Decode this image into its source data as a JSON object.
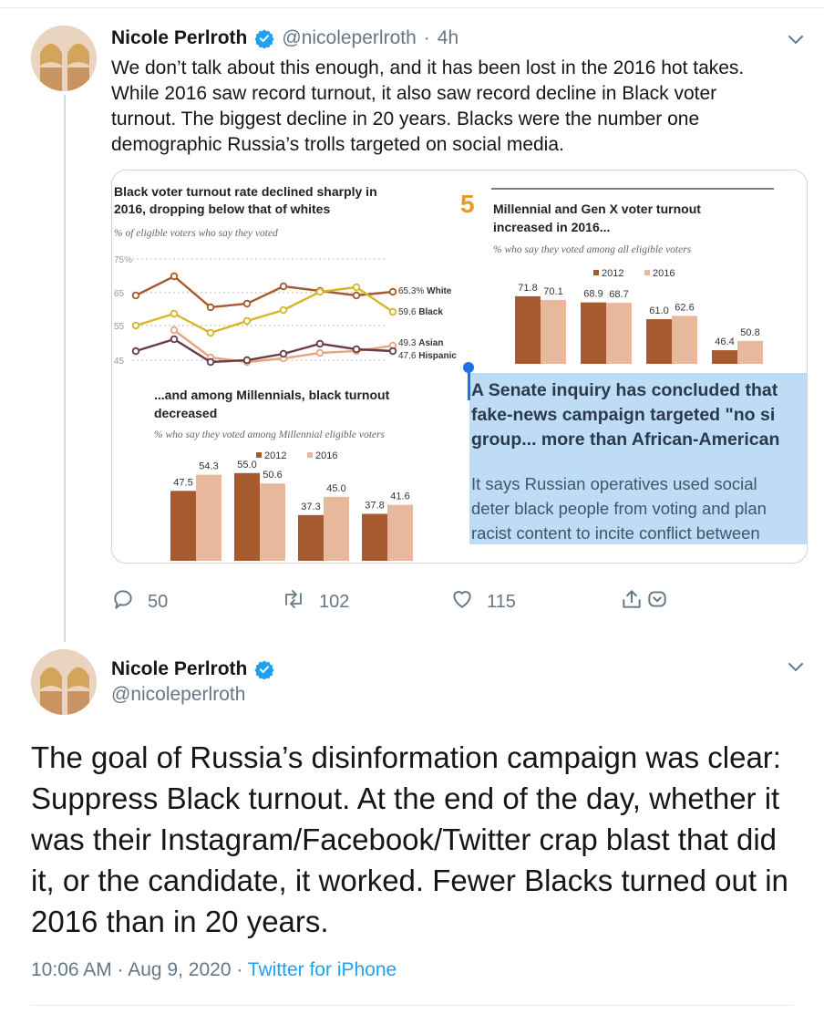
{
  "tweet1": {
    "name": "Nicole Perlroth",
    "handle": "@nicoleperlroth",
    "time": "4h",
    "text": "We don’t talk about this enough, and it has been lost in the 2016 hot takes. While 2016 saw record turnout, it also saw record decline in Black voter turnout. The biggest decline in 20 years. Blacks were the number one demographic Russia’s trolls targeted on social media.",
    "actions": {
      "replies": "50",
      "retweets": "102",
      "likes": "115"
    }
  },
  "media": {
    "line_chart": {
      "title": "Black voter turnout rate declined sharply in 2016, dropping below that of whites",
      "subtitle": "% of eligible voters who say they voted",
      "y_ticks": [
        "75%",
        "65",
        "55",
        "45"
      ],
      "labels": [
        {
          "value": "65.3%",
          "name": "White"
        },
        {
          "value": "59.6",
          "name": "Black"
        },
        {
          "value": "49.3",
          "name": "Asian"
        },
        {
          "value": "47.6",
          "name": "Hispanic"
        }
      ]
    },
    "millennial_chart": {
      "title": "...and among Millennials, black turnout decreased",
      "subtitle": "% who say they voted among Millennial eligible voters",
      "legend": [
        "2012",
        "2016"
      ],
      "values_2012": [
        47.5,
        55.0,
        37.3,
        37.8
      ],
      "values_2016": [
        54.3,
        50.6,
        45.0,
        41.6
      ],
      "labels_2012": [
        "47.5",
        "55.0",
        "37.3",
        "37.8"
      ],
      "labels_2016": [
        "54.3",
        "50.6",
        "45.0",
        "41.6"
      ]
    },
    "genx_chart": {
      "number": "5",
      "title": "Millennial and Gen X voter turnout increased in 2016...",
      "subtitle": "% who say they voted among all eligible voters",
      "legend": [
        "2012",
        "2016"
      ],
      "values_2012": [
        71.8,
        68.9,
        61.0,
        46.4
      ],
      "values_2016": [
        70.1,
        68.7,
        62.6,
        50.8
      ],
      "labels_2012": [
        "71.8",
        "68.9",
        "61.0",
        "46.4"
      ],
      "labels_2016": [
        "70.1",
        "68.7",
        "62.6",
        "50.8"
      ]
    },
    "article": {
      "headline_lines": [
        "A Senate inquiry has concluded that",
        "fake-news campaign targeted \"no si",
        "group... more than African-American"
      ],
      "body_lines": [
        "It says Russian operatives used social",
        "deter black people from voting and plan",
        "racist content to incite conflict between"
      ]
    },
    "colors": {
      "c2012": "#a65a2e",
      "c2016": "#e8b89c",
      "white": "#a65a2e",
      "black": "#d6b528",
      "asian": "#e7a57f",
      "hispanic": "#6b3a4a"
    }
  },
  "tweet2": {
    "name": "Nicole Perlroth",
    "handle": "@nicoleperlroth",
    "text": "The goal of Russia’s disinformation campaign was clear: Suppress Black turnout. At the end of the day, whether it was their Instagram/Facebook/Twitter crap blast that did it, or the candidate, it worked. Fewer Blacks turned out in 2016 than in 20 years.",
    "timestamp": "10:06 AM · Aug 9, 2020 ·",
    "source": "Twitter for iPhone"
  },
  "icons": [
    "verified-badge-icon",
    "chevron-down-icon",
    "reply-icon",
    "retweet-icon",
    "like-icon",
    "share-icon"
  ]
}
